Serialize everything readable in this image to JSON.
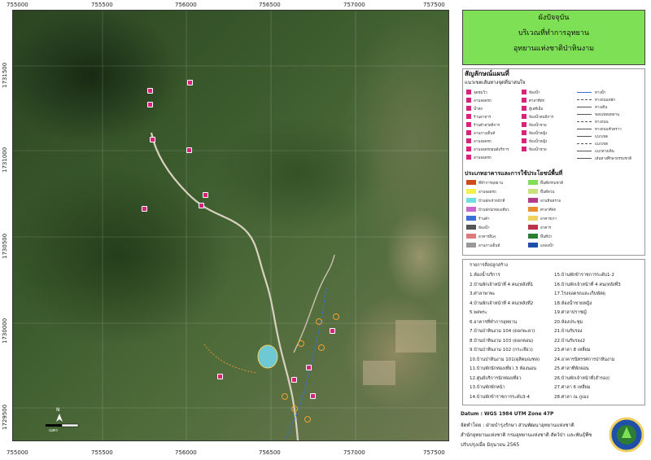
{
  "title": {
    "line1": "ผังปัจจุบัน",
    "line2": "บริเวณที่ทำการอุทยาน",
    "line3": "อุทยานแห่งชาติป่าหินงาม"
  },
  "axes": {
    "x_ticks_top": [
      "755000",
      "755500",
      "756000",
      "756500",
      "757000",
      "757500"
    ],
    "x_ticks_bottom": [
      "755000",
      "755500",
      "756000",
      "756500",
      "757000",
      "757500"
    ],
    "y_ticks": [
      "1731500",
      "1731000",
      "1730500",
      "1730000",
      "1729500"
    ]
  },
  "legend": {
    "heading": "สัญลักษณ์แผนที่",
    "sub_heading": "แนวเขตเส้นทางจุดที่น่าสนใจ",
    "symbols_col1": [
      "จุดชมวิว",
      "ลานจอดรถ",
      "น้ำตก",
      "ร้านอาหาร",
      "ร้านค้าสวัสดิการ",
      "ลานกางเต็นท์",
      "ลานจอดรถ",
      "ลานจอดรถยนต์บริการ",
      "ลานจอดรถ"
    ],
    "symbols_col2": [
      "ห้องน้ำ",
      "ศาลาที่พัก",
      "ตู้เอทีเอ็ม",
      "ห้องน้ำคนพิการ",
      "ห้องน้ำชาย",
      "ห้องน้ำหญิง",
      "ห้องน้ำหญิง",
      "ห้องน้ำชาย"
    ],
    "lines": [
      "ทางน้ำ",
      "ทางถนนหลัก",
      "ทางเดิน",
      "ขอบเขตอุทยาน",
      "ทางถนน",
      "ทางถนนชั่วคราว",
      "แนวเขต",
      "แนวเขต",
      "แนวทางเดิน",
      "เส้นทางศึกษาธรรมชาติ"
    ],
    "landuse_heading": "ประเภทอาคารและการใช้ประโยชน์พื้นที่",
    "landuse_col1": [
      "ที่ทำการอุทยาน",
      "ลานจอดรถ",
      "บ้านพักเจ้าหน้าที่",
      "บ้านพักนักท่องเที่ยว",
      "ร้านค้า",
      "ห้องน้ำ",
      "อาคารอื่นๆ",
      "ลานกางเต็นท์"
    ],
    "landuse_col2": [
      "พื้นที่ธรรมชาติ",
      "พื้นที่สวน",
      "ลานหินทราย",
      "ศาลาที่พัก",
      "อาคารเก่า",
      "อาคาร",
      "พื้นที่ป่า",
      "แหล่งน้ำ"
    ],
    "colors": {
      "landuse_col1": [
        "#d14a1e",
        "#f4f04a",
        "#6ee0e0",
        "#cc66cc",
        "#3a6fd8",
        "#555555",
        "#e07a7a",
        "#999999"
      ],
      "landuse_col2": [
        "#7ee054",
        "#c7e27a",
        "#b53a8a",
        "#e89030",
        "#f0d060",
        "#c0304a",
        "#2e7d32",
        "#1f4fa8"
      ]
    }
  },
  "buildings": {
    "heading": "รายการสิ่งปลูกสร้าง",
    "col1": [
      "1.ห้องน้ำบริการ",
      "2.บ้านพักเจ้าหน้าที่ 4 คน(หลังที่1",
      "3.ศาลาพาพะ",
      "4.บ้านพักเจ้าหน้าที่ 4 คน(หลังที่2",
      "5.พลพระ",
      "6.อาคารที่ทำการอุทยาน",
      "7.บ้านป่าหินงาม 104 (ดอกพะยา)",
      "8.บ้านป่าหินงาม 103 (ดอกคอน)",
      "9.บ้านป่าหินงาม 102 (กระเจียว)",
      "10.บ้านป่าหินงาม 101(ดุสิตมณฑล)",
      "11.บ้านพักนักท่องเที่ยว 3 ห้องนอน",
      "12.ศูนย์บริการนักท่องเที่ยว",
      "13.บ้านพักพักหน้า",
      "14.บ้านพักข้าราชการระดับ3-4"
    ],
    "col2": [
      "15.บ้านพักข้าราชการระดับ1-2",
      "16.บ้านพักเจ้าหน้าที่ 4 คน(หลังที่3",
      "17.โรงจอดรถและเก็บพัสดุ",
      "18.ห้องน้ำชายหญิง",
      "19.ศาลาปราชญ์",
      "20.ห้องประชุม",
      "21.บ้านรับรอง",
      "22.บ้านรับรอง2",
      "23.ศาลา 8 เหลี่ยม",
      "24.อาคารนิทรรศการป่าหินงาม",
      "25.ศาลาที่พักผ่อน",
      "26.บ้านพักเจ้าหน้าที่(สำรอง)",
      "27.ศาลา 6 เหลี่ยม",
      "28.ศาลา ณ ภูเมง"
    ]
  },
  "footer": {
    "datum": "Datum : WGS 1984 UTM Zone 47P",
    "made_by": "จัดทำโดย : ฝ่ายบำรุงรักษา ส่วนพัฒนาอุทยานแห่งชาติ",
    "agency": "สำนักอุทยานแห่งชาติ กรมอุทยานแห่งชาติ สัตว์ป่า และพันธุ์พืช",
    "updated": "ปรับปรุงเมื่อ มิถุนายน 2565"
  },
  "scale_label": "เมตร",
  "north_label": "N",
  "map_colors": {
    "road": "#d8d0c0",
    "trail": "#3a6fd8",
    "poi": "#d6247a",
    "pond": "#6ec9d4"
  }
}
